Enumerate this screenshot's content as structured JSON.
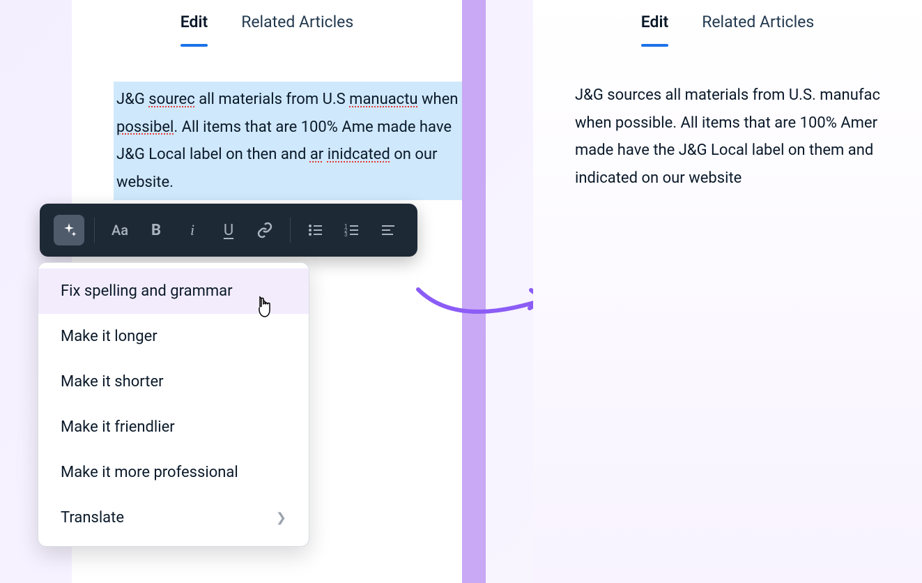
{
  "left": {
    "tabs": [
      {
        "label": "Edit",
        "active": true
      },
      {
        "label": "Related Articles",
        "active": false
      }
    ],
    "text_parts": {
      "p1": "J&G ",
      "m1": "sourec",
      "p2": " all materials from U.S ",
      "m2": "manuactu",
      "p3": " when ",
      "m3": "possibel",
      "p4": ". All items that are 100% Ame",
      "p5": " made have J&G Local label on then and ",
      "m4": "ar",
      "p6": " ",
      "m5": "inidcated",
      "p7": " on our website."
    }
  },
  "right": {
    "tabs": [
      {
        "label": "Edit",
        "active": true
      },
      {
        "label": "Related Articles",
        "active": false
      }
    ],
    "text": "J&G sources all materials from U.S. manufac when possible. All items that are 100% Amer made have the J&G Local label on them and indicated on our website"
  },
  "toolbar": {
    "items": [
      "ai",
      "sep",
      "font",
      "bold",
      "italic",
      "underline",
      "link",
      "sep",
      "bullets",
      "numbers",
      "align"
    ]
  },
  "ai_menu": {
    "items": [
      {
        "label": "Fix spelling and grammar",
        "hovered": true,
        "submenu": false
      },
      {
        "label": "Make it longer",
        "hovered": false,
        "submenu": false
      },
      {
        "label": "Make it shorter",
        "hovered": false,
        "submenu": false
      },
      {
        "label": "Make it friendlier",
        "hovered": false,
        "submenu": false
      },
      {
        "label": "Make it more professional",
        "hovered": false,
        "submenu": false
      },
      {
        "label": "Translate",
        "hovered": false,
        "submenu": true
      }
    ]
  },
  "colors": {
    "accent": "#1a73e8",
    "toolbar_bg": "#1e2936",
    "highlight": "#cfe8fb",
    "purple_divider": "#c9a8f5",
    "arrow": "#8b5cf6"
  }
}
